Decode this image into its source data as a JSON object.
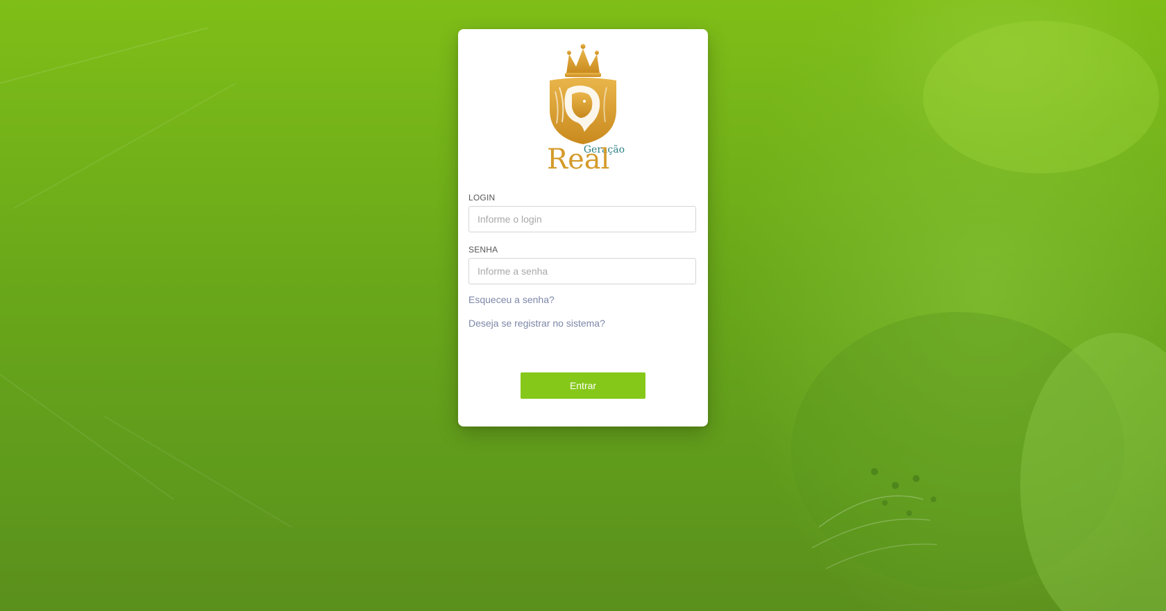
{
  "colors": {
    "background_green": "#6aa81a",
    "button_green": "#86c81a",
    "logo_gold": "#d49a2a",
    "logo_teal": "#2a7f86",
    "link_color": "#7d87a8"
  },
  "logo": {
    "icon": "crowned-lion-shield-icon",
    "word_top": "Geração",
    "word_bottom": "Real"
  },
  "form": {
    "login_label": "LOGIN",
    "login_placeholder": "Informe o login",
    "login_value": "",
    "password_label": "SENHA",
    "password_placeholder": "Informe a senha",
    "password_value": "",
    "forgot_password_link": "Esqueceu a senha?",
    "register_link": "Deseja se registrar no sistema?",
    "submit_button": "Entrar"
  }
}
